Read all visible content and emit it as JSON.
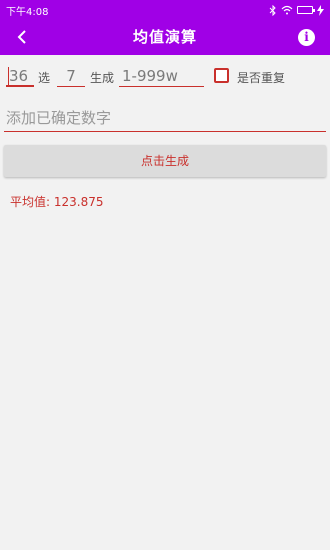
{
  "statusbar": {
    "time": "下午4:08",
    "bluetooth": "bluetooth-icon",
    "wifi": "wifi-icon",
    "battery_text": "x",
    "signal": "charging-icon"
  },
  "appbar": {
    "title": "均值演算",
    "back": "back-icon",
    "info": "i",
    "color": "#a000e6"
  },
  "row1": {
    "total_value": "36",
    "select_label": "选",
    "pick_value": "7",
    "generate_label": "生成",
    "range_placeholder": "1-999w",
    "checkbox_checked": false,
    "checkbox_label": "是否重复"
  },
  "fixed": {
    "placeholder": "添加已确定数字"
  },
  "button": {
    "label": "点击生成"
  },
  "result": {
    "text": "平均值: 123.875"
  },
  "colors": {
    "accent": "#c9302c",
    "background": "#f2f2f2"
  }
}
